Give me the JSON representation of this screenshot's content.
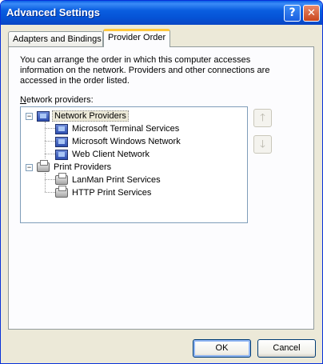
{
  "window": {
    "title": "Advanced Settings"
  },
  "titlebar": {
    "help_symbol": "?",
    "close_symbol": "✕"
  },
  "tabs": [
    {
      "label": "Adapters and Bindings",
      "active": false
    },
    {
      "label": "Provider Order",
      "active": true
    }
  ],
  "description": "You can arrange the order in which this computer accesses information on the network.  Providers and other connections are accessed in the order listed.",
  "network_providers_label": {
    "accel": "N",
    "rest": "etwork providers:"
  },
  "tree": {
    "network_group": {
      "label": "Network Providers",
      "expander": "−",
      "icon": "network-icon",
      "children": [
        {
          "label": "Microsoft Terminal Services",
          "icon": "network-icon"
        },
        {
          "label": "Microsoft Windows Network",
          "icon": "network-icon"
        },
        {
          "label": "Web Client Network",
          "icon": "network-icon"
        }
      ]
    },
    "print_group": {
      "label": "Print Providers",
      "expander": "−",
      "icon": "printer-icon",
      "children": [
        {
          "label": "LanMan Print Services",
          "icon": "printer-icon"
        },
        {
          "label": "HTTP Print Services",
          "icon": "printer-icon"
        }
      ]
    }
  },
  "move_up": {
    "symbol": "🡑",
    "icon": "arrow-up-icon"
  },
  "move_down": {
    "symbol": "🡓",
    "icon": "arrow-down-icon"
  },
  "buttons": {
    "ok": "OK",
    "cancel": "Cancel"
  }
}
